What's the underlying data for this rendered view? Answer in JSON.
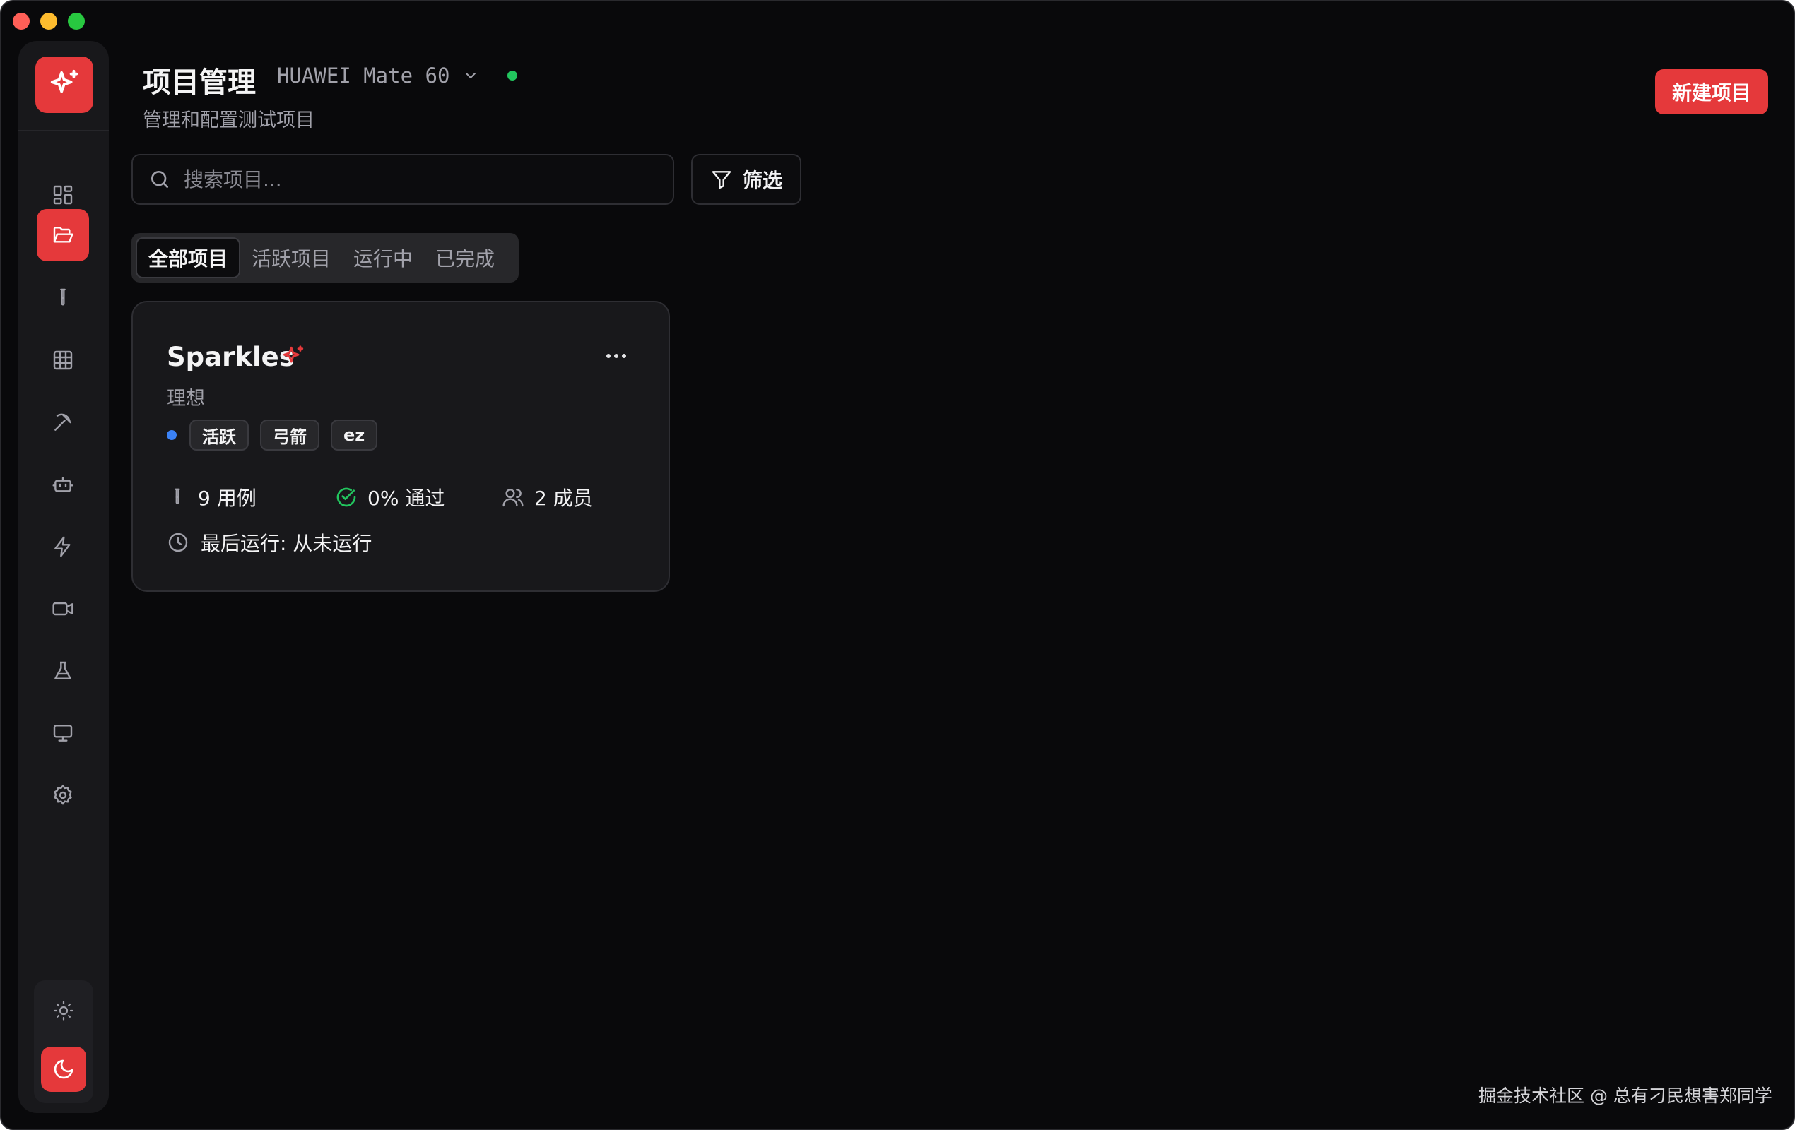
{
  "header": {
    "title": "项目管理",
    "device": "HUAWEI Mate 60",
    "subtitle": "管理和配置测试项目",
    "new_project_label": "新建项目"
  },
  "search": {
    "placeholder": "搜索项目..."
  },
  "filter": {
    "label": "筛选"
  },
  "tabs": [
    {
      "label": "全部项目",
      "active": true
    },
    {
      "label": "活跃项目",
      "active": false
    },
    {
      "label": "运行中",
      "active": false
    },
    {
      "label": "已完成",
      "active": false
    }
  ],
  "sidebar": {
    "items": [
      {
        "icon": "dashboard-icon"
      },
      {
        "icon": "folder-open-icon",
        "active": true
      },
      {
        "icon": "test-tube-icon"
      },
      {
        "icon": "grid-icon"
      },
      {
        "icon": "pickaxe-icon"
      },
      {
        "icon": "bot-icon"
      },
      {
        "icon": "zap-icon"
      },
      {
        "icon": "video-icon"
      },
      {
        "icon": "flask-icon"
      },
      {
        "icon": "monitor-icon"
      },
      {
        "icon": "settings-icon"
      }
    ],
    "theme": {
      "light_icon": "sun-icon",
      "dark_icon": "moon-icon",
      "selected": "dark"
    }
  },
  "project": {
    "name": "Sparkles",
    "description": "理想",
    "status_color": "#3b82f6",
    "tags": [
      "活跃",
      "弓箭",
      "ez"
    ],
    "cases": "9 用例",
    "pass_rate": "0% 通过",
    "members": "2 成员",
    "last_run": "最后运行: 从未运行"
  },
  "watermark": "掘金技术社区 @ 总有刁民想害郑同学",
  "colors": {
    "accent": "#e5393b",
    "background": "#09090b",
    "success": "#22c55e"
  }
}
